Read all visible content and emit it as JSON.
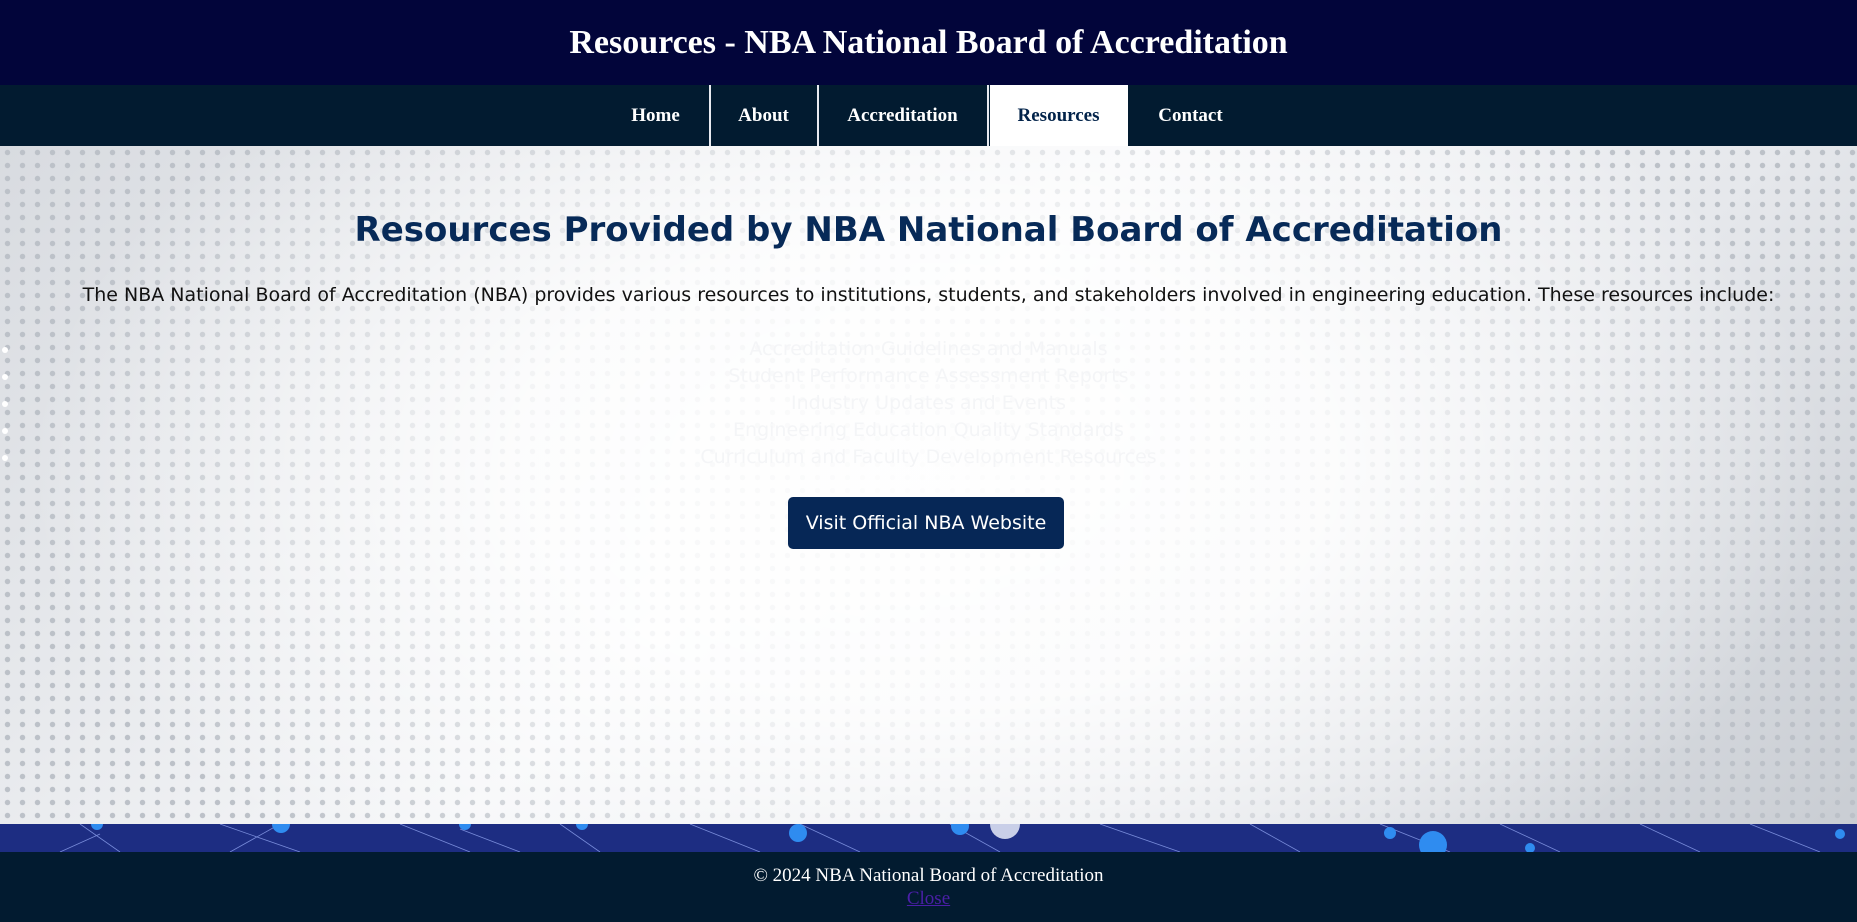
{
  "header": {
    "title": "Resources - NBA National Board of Accreditation"
  },
  "nav": {
    "items": [
      {
        "label": "Home"
      },
      {
        "label": "About"
      },
      {
        "label": "Accreditation"
      },
      {
        "label": "Resources",
        "active": true
      },
      {
        "label": "Contact"
      }
    ]
  },
  "main": {
    "heading": "Resources Provided by NBA National Board of Accreditation",
    "intro": "The NBA National Board of Accreditation (NBA) provides various resources to institutions, students, and stakeholders involved in engineering education. These resources include:",
    "resources": [
      "Accreditation Guidelines and Manuals",
      "Student Performance Assessment Reports",
      "Industry Updates and Events",
      "Engineering Education Quality Standards",
      "Curriculum and Faculty Development Resources"
    ],
    "visit_button": "Visit Official NBA Website"
  },
  "footer": {
    "copyright": "© 2024 NBA National Board of Accreditation",
    "close_link": "Close"
  },
  "colors": {
    "header_bg": "#02053a",
    "nav_bg": "#021b30",
    "heading": "#072a58",
    "button_bg": "#062756",
    "footer_bg": "#021b30",
    "network_strip": "#1d2d82"
  }
}
